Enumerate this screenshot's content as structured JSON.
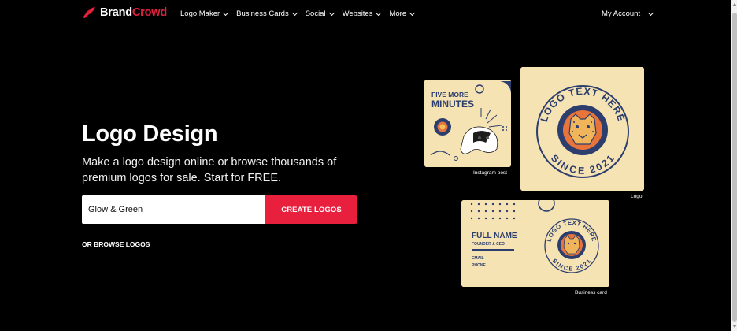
{
  "brand": {
    "name_part1": "Brand",
    "name_part2": "Crowd",
    "accent_color": "#e8203e",
    "logo_icon": "rocket-bird-icon"
  },
  "nav": {
    "items": [
      {
        "label": "Logo Maker"
      },
      {
        "label": "Business Cards"
      },
      {
        "label": "Social"
      },
      {
        "label": "Websites"
      },
      {
        "label": "More"
      }
    ],
    "account_label": "My Account"
  },
  "hero": {
    "title": "Logo Design",
    "subtitle": "Make a logo design online or browse thousands of premium logos for sale. Start for FREE."
  },
  "search": {
    "value": "Glow & Green",
    "button_label": "CREATE LOGOS"
  },
  "browse_label": "OR BROWSE LOGOS",
  "previews": {
    "instagram": {
      "caption": "Instagram post",
      "headline_line1": "FIVE MORE",
      "headline_line2": "MINUTES"
    },
    "logo": {
      "caption": "Logo",
      "ring_top": "LOGO TEXT HERE",
      "ring_bottom": "SINCE 2021"
    },
    "business_card": {
      "caption": "Business card",
      "name": "FULL NAME",
      "role": "FOUNDER & CEO",
      "email_label": "EMAIL",
      "phone_label": "PHONE",
      "ring_top": "LOGO TEXT HERE",
      "ring_bottom": "SINCE 2021"
    }
  },
  "colors": {
    "background": "#000000",
    "card_cream": "#f6e3b4",
    "navy": "#2c3e6e",
    "cheetah_orange": "#e8743b"
  }
}
